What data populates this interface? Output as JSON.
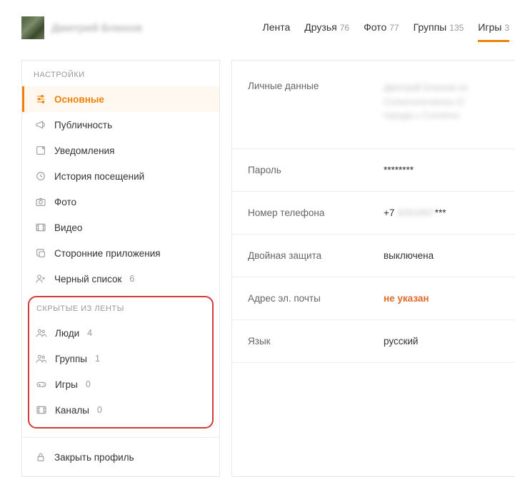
{
  "header": {
    "username_obscured": "Дмитрий Блинов",
    "nav": [
      {
        "label": "Лента",
        "count": "",
        "active": false
      },
      {
        "label": "Друзья",
        "count": "76",
        "active": false
      },
      {
        "label": "Фото",
        "count": "77",
        "active": false
      },
      {
        "label": "Группы",
        "count": "135",
        "active": false
      },
      {
        "label": "Игры",
        "count": "3",
        "active": true
      }
    ]
  },
  "sidebar": {
    "settings_title": "НАСТРОЙКИ",
    "items": [
      {
        "icon": "sliders",
        "label": "Основные",
        "count": "",
        "active": true
      },
      {
        "icon": "megaphone",
        "label": "Публичность",
        "count": "",
        "active": false
      },
      {
        "icon": "bell-box",
        "label": "Уведомления",
        "count": "",
        "active": false
      },
      {
        "icon": "history",
        "label": "История посещений",
        "count": "",
        "active": false
      },
      {
        "icon": "camera",
        "label": "Фото",
        "count": "",
        "active": false
      },
      {
        "icon": "film",
        "label": "Видео",
        "count": "",
        "active": false
      },
      {
        "icon": "apps",
        "label": "Сторонние приложения",
        "count": "",
        "active": false
      },
      {
        "icon": "user-x",
        "label": "Черный список",
        "count": "6",
        "active": false
      }
    ],
    "hidden_title": "СКРЫТЫЕ ИЗ ЛЕНТЫ",
    "hidden_items": [
      {
        "icon": "users",
        "label": "Люди",
        "count": "4"
      },
      {
        "icon": "users",
        "label": "Группы",
        "count": "1"
      },
      {
        "icon": "gamepad",
        "label": "Игры",
        "count": "0"
      },
      {
        "icon": "film",
        "label": "Каналы",
        "count": "0"
      }
    ],
    "close_profile": {
      "icon": "lock",
      "label": "Закрыть профиль"
    }
  },
  "content": {
    "rows": [
      {
        "key": "Личные данные",
        "value_obscured": "Дмитрий Блинов из\nСолнечногорска (С\nгорода с Солнечн",
        "type": "blur-multi"
      },
      {
        "key": "Пароль",
        "value": "********"
      },
      {
        "key": "Номер телефона",
        "value_prefix": "+7 ",
        "value_blur": "9261897",
        "value_suffix": "***",
        "type": "phone"
      },
      {
        "key": "Двойная защита",
        "value": "выключена"
      },
      {
        "key": "Адрес эл. почты",
        "value": "не указан",
        "type": "warn"
      },
      {
        "key": "Язык",
        "value": "русский"
      }
    ]
  }
}
